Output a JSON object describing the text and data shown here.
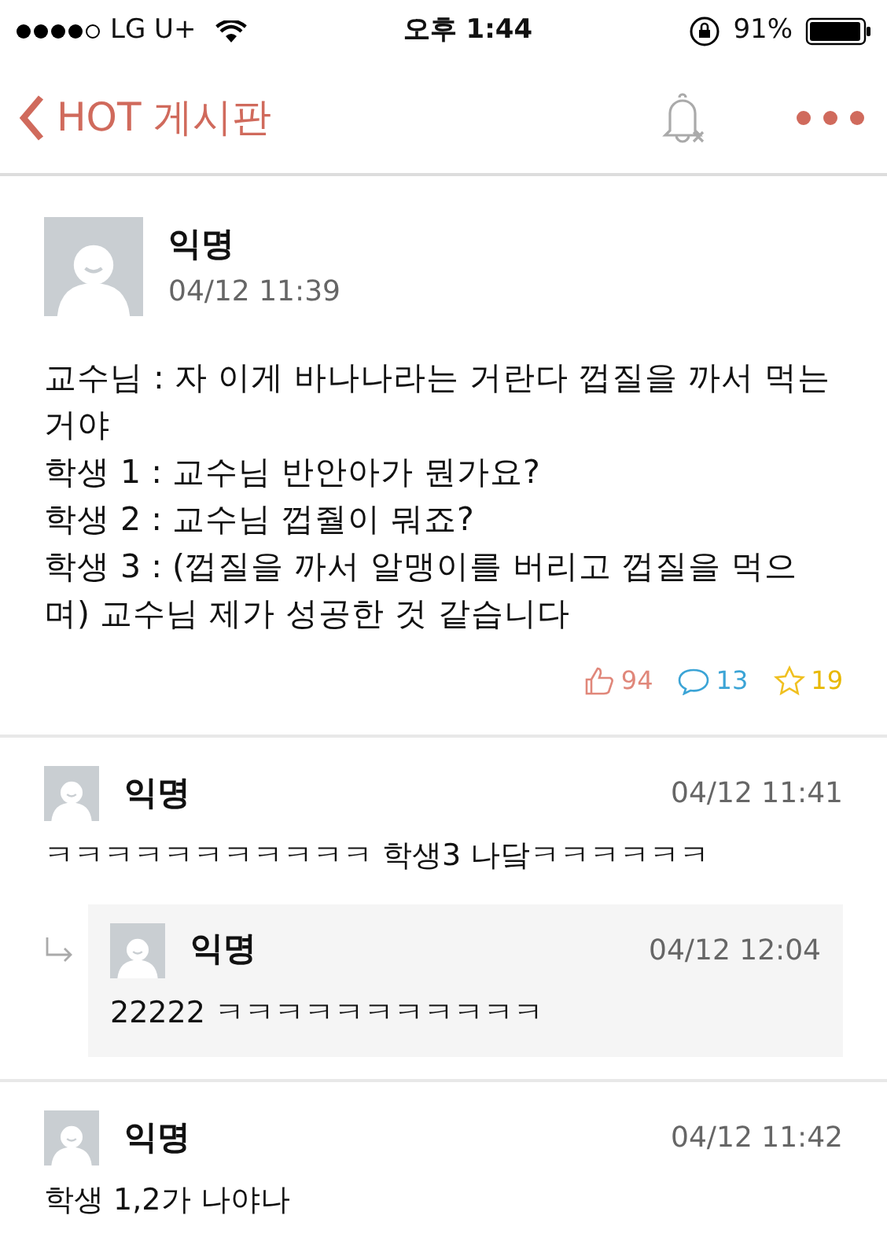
{
  "status_bar": {
    "carrier": "LG U+",
    "time": "오후 1:44",
    "battery": "91%"
  },
  "nav": {
    "title": "HOT 게시판"
  },
  "post": {
    "author": "익명",
    "date": "04/12 11:39",
    "lines": [
      "교수님 : 자 이게 바나나라는 거란다 껍질을 까서 먹는거야",
      "학생 1 : 교수님 반안아가 뭔가요?",
      "학생 2 : 교수님 껍줠이 뭐죠?",
      "학생 3 : (껍질을 까서 알맹이를 버리고 껍질을 먹으며) 교수님 제가 성공한 것 같습니다"
    ],
    "likes": "94",
    "comments": "13",
    "scraps": "19"
  },
  "comments": [
    {
      "author": "익명",
      "date": "04/12 11:41",
      "text": "ㅋㅋㅋㅋㅋㅋㅋㅋㅋㅋㅋ 학생3 나닼ㅋㅋㅋㅋㅋㅋ",
      "children": [
        {
          "author": "익명",
          "date": "04/12 12:04",
          "text": "22222 ㅋㅋㅋㅋㅋㅋㅋㅋㅋㅋㅋ"
        }
      ]
    },
    {
      "author": "익명",
      "date": "04/12 11:42",
      "text": "학생 1,2가 나야나"
    }
  ]
}
